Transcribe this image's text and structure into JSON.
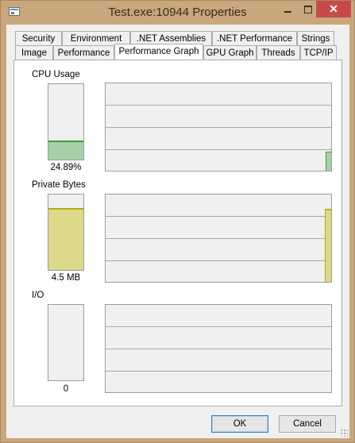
{
  "window": {
    "title": "Test.exe:10944 Properties"
  },
  "titlebar_buttons": {
    "close": "✕"
  },
  "tabs_row1": [
    "Security",
    "Environment",
    ".NET Assemblies",
    ".NET Performance",
    "Strings"
  ],
  "tabs_row2": [
    "Image",
    "Performance",
    "Performance Graph",
    "GPU Graph",
    "Threads",
    "TCP/IP"
  ],
  "active_tab": "Performance Graph",
  "sections": {
    "cpu": {
      "label": "CPU Usage",
      "value": "24.89%",
      "level": 0.25,
      "color": "#3e9a3e"
    },
    "private_bytes": {
      "label": "Private Bytes",
      "value": "4.5 MB",
      "level": 0.82,
      "color": "#b5ad12"
    },
    "io": {
      "label": "I/O",
      "value": "0",
      "level": 0
    }
  },
  "buttons": {
    "ok": "OK",
    "cancel": "Cancel"
  }
}
